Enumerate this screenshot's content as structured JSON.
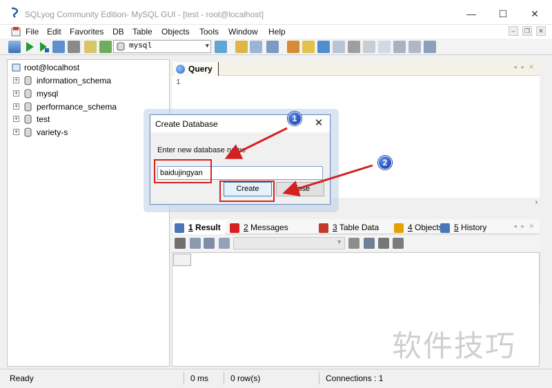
{
  "window": {
    "title": "SQLyog Community Edition- MySQL GUI - [test - root@localhost]",
    "minimize_glyph": "—",
    "maximize_glyph": "☐",
    "close_glyph": "✕"
  },
  "menu": {
    "items": [
      "File",
      "Edit",
      "Favorites",
      "DB",
      "Table",
      "Objects",
      "Tools",
      "Window",
      "Help"
    ],
    "mdi_minimize": "–",
    "mdi_restore": "❐",
    "mdi_close": "✕"
  },
  "toolbar": {
    "selected_database": "mysql"
  },
  "object_browser": {
    "connection": "root@localhost",
    "databases": [
      "information_schema",
      "mysql",
      "performance_schema",
      "test",
      "variety-s"
    ],
    "expand_glyph": "+"
  },
  "query": {
    "tab_label": "Query",
    "line_number": "1"
  },
  "result_tabs": [
    {
      "num": "1",
      "label": "Result",
      "icon": "table-icon",
      "color": "#4a76b8"
    },
    {
      "num": "2",
      "label": "Messages",
      "icon": "error-icon",
      "color": "#d62020"
    },
    {
      "num": "3",
      "label": "Table Data",
      "icon": "table-data-icon",
      "color": "#c0392b"
    },
    {
      "num": "4",
      "label": "Objects",
      "icon": "objects-icon",
      "color": "#e6a100"
    },
    {
      "num": "5",
      "label": "History",
      "icon": "history-icon",
      "color": "#4a76b8"
    }
  ],
  "statusbar": {
    "status": "Ready",
    "exec_time": "0 ms",
    "rows": "0 row(s)",
    "connections": "Connections : 1"
  },
  "dialog": {
    "title": "Create Database",
    "prompt": "Enter new database name",
    "input_value": "baidujingyan",
    "create_label": "Create",
    "close_label": "Close",
    "close_glyph": "✕"
  },
  "annotations": {
    "badge_1": "1",
    "badge_2": "2",
    "color": "#d42020"
  },
  "watermark": "软件技巧"
}
